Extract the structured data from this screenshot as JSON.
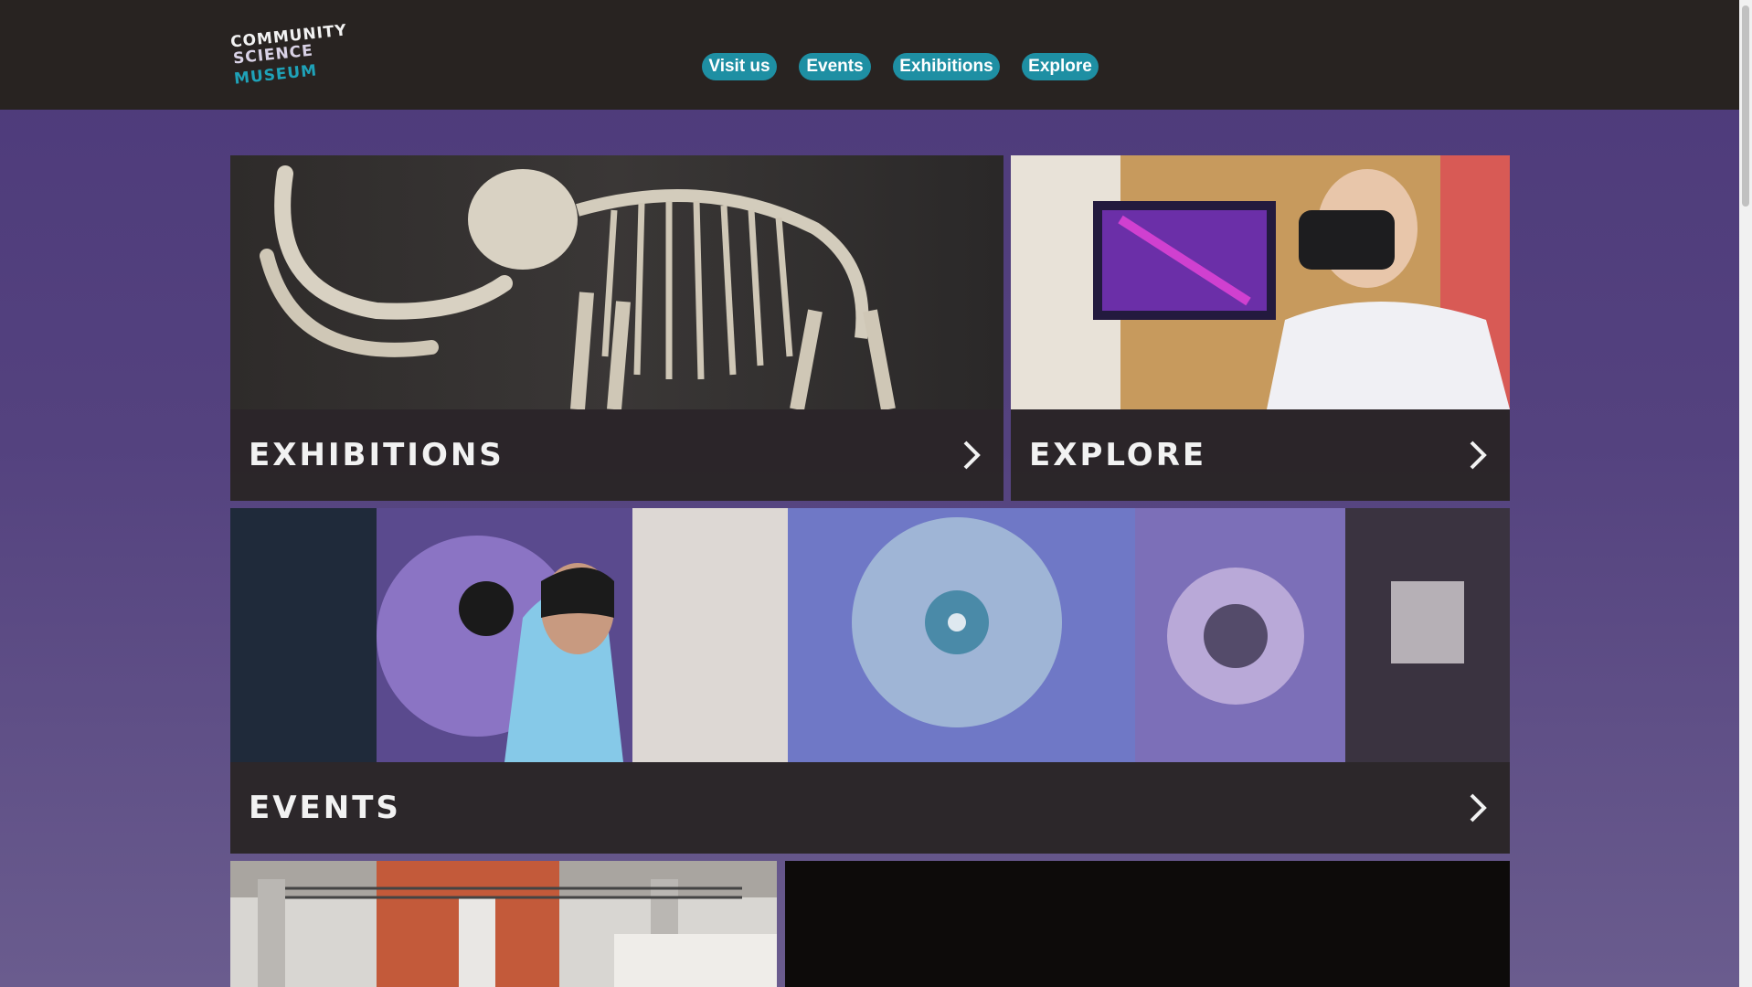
{
  "logo": {
    "line1": "COMMUNITY",
    "line2": "SCIENCE",
    "line3": "MUSEUM"
  },
  "nav": [
    {
      "label": "Visit us"
    },
    {
      "label": "Events"
    },
    {
      "label": "Exhibitions"
    },
    {
      "label": "Explore"
    }
  ],
  "cards": {
    "exhibitions": {
      "label": "EXHIBITIONS",
      "icon": "chevron-right-icon"
    },
    "explore": {
      "label": "EXPLORE",
      "icon": "chevron-right-icon"
    },
    "events": {
      "label": "EVENTS",
      "icon": "chevron-right-icon"
    }
  },
  "colors": {
    "header_bg": "#282321",
    "accent": "#1e8fa3",
    "page_bg": "#4d3a7a"
  }
}
